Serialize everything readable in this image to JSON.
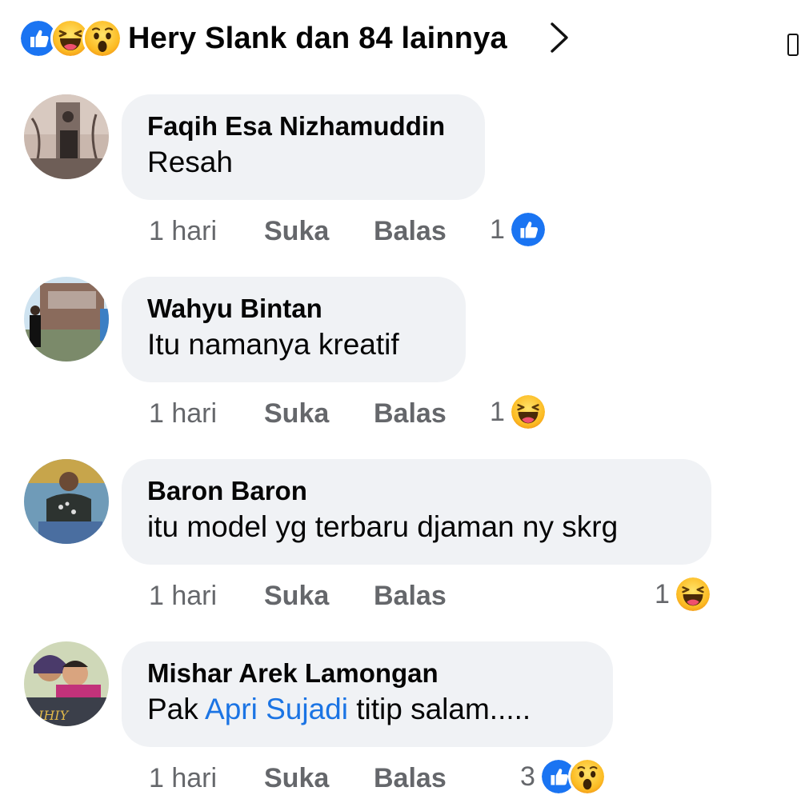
{
  "header": {
    "summary": "Hery Slank dan 84 lainnya",
    "reactions": [
      "like-icon",
      "haha-icon",
      "wow-icon"
    ]
  },
  "comments": [
    {
      "author": "Faqih Esa Nizhamuddin",
      "text": "Resah",
      "time": "1 hari",
      "like_label": "Suka",
      "reply_label": "Balas",
      "reaction_count": "1",
      "reactions": [
        "like-icon"
      ]
    },
    {
      "author": "Wahyu Bintan",
      "text": "Itu namanya kreatif",
      "time": "1 hari",
      "like_label": "Suka",
      "reply_label": "Balas",
      "reaction_count": "1",
      "reactions": [
        "haha-icon"
      ]
    },
    {
      "author": "Baron Baron",
      "text": "itu model yg terbaru djaman ny skrg",
      "time": "1 hari",
      "like_label": "Suka",
      "reply_label": "Balas",
      "reaction_count": "1",
      "reactions": [
        "haha-icon"
      ]
    },
    {
      "author": "Mishar Arek Lamongan",
      "text_prefix": "Pak",
      "mention": "Apri Sujadi",
      "text_suffix": "titip salam.....",
      "time": "1 hari",
      "like_label": "Suka",
      "reply_label": "Balas",
      "reaction_count": "3",
      "reactions": [
        "like-icon",
        "wow-icon"
      ]
    }
  ],
  "colors": {
    "bubble": "#f0f2f5",
    "meta_text": "#65676b",
    "mention": "#1b74e4",
    "like_blue": "#1877f2",
    "emoji_yellow": "#fdb820"
  }
}
